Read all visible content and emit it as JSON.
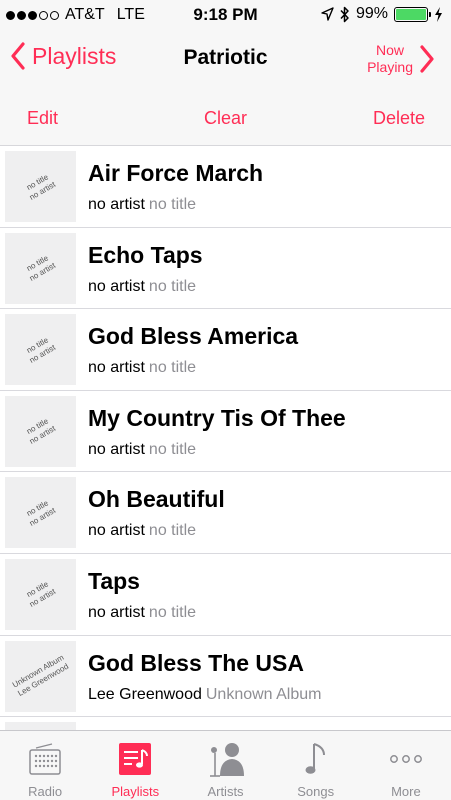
{
  "status": {
    "carrier": "AT&T",
    "network": "LTE",
    "time": "9:18 PM",
    "battery": "99%",
    "battery_level": 0.99
  },
  "nav": {
    "back_label": "Playlists",
    "title": "Patriotic",
    "now_playing_line1": "Now",
    "now_playing_line2": "Playing"
  },
  "actions": {
    "edit": "Edit",
    "clear": "Clear",
    "delete": "Delete"
  },
  "songs": [
    {
      "title": "Air Force March",
      "artist": "no artist",
      "album": "no title",
      "art_line1": "no title",
      "art_line2": "no artist"
    },
    {
      "title": "Echo Taps",
      "artist": "no artist",
      "album": "no title",
      "art_line1": "no title",
      "art_line2": "no artist"
    },
    {
      "title": "God Bless America",
      "artist": "no artist",
      "album": "no title",
      "art_line1": "no title",
      "art_line2": "no artist"
    },
    {
      "title": "My Country Tis Of Thee",
      "artist": "no artist",
      "album": "no title",
      "art_line1": "no title",
      "art_line2": "no artist"
    },
    {
      "title": "Oh Beautiful",
      "artist": "no artist",
      "album": "no title",
      "art_line1": "no title",
      "art_line2": "no artist"
    },
    {
      "title": "Taps",
      "artist": "no artist",
      "album": "no title",
      "art_line1": "no title",
      "art_line2": "no artist"
    },
    {
      "title": "God Bless The USA",
      "artist": "Lee Greenwood",
      "album": "Unknown Album",
      "art_line1": "Unknown Album",
      "art_line2": "Lee Greenwood"
    }
  ],
  "tabs": [
    {
      "label": "Radio",
      "icon": "radio-icon",
      "active": false
    },
    {
      "label": "Playlists",
      "icon": "playlists-icon",
      "active": true
    },
    {
      "label": "Artists",
      "icon": "artists-icon",
      "active": false
    },
    {
      "label": "Songs",
      "icon": "songs-icon",
      "active": false
    },
    {
      "label": "More",
      "icon": "more-icon",
      "active": false
    }
  ],
  "colors": {
    "accent": "#ff2d55",
    "inactive": "#8e8e93",
    "battery_fill": "#4cd964"
  }
}
